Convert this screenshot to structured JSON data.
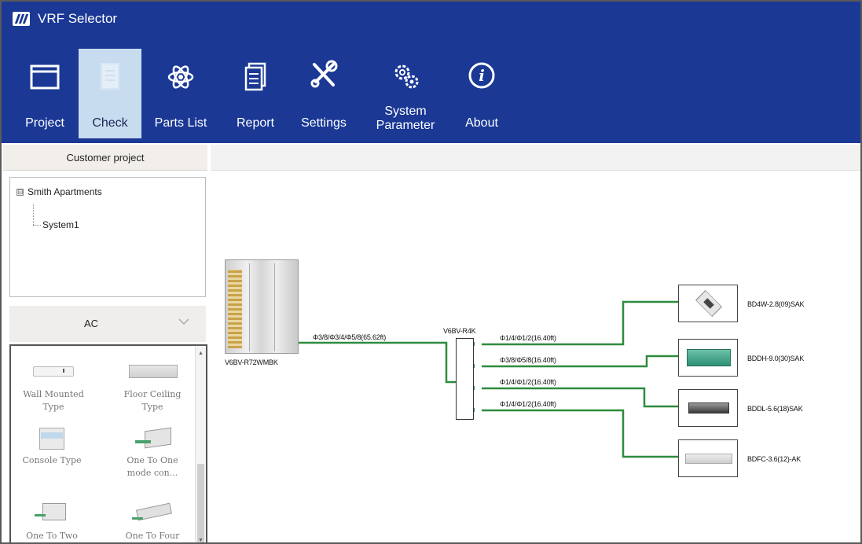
{
  "app": {
    "title": "VRF Selector"
  },
  "toolbar": {
    "project": "Project",
    "check": "Check",
    "parts_list": "Parts List",
    "report": "Report",
    "settings": "Settings",
    "system_parameter_line1": "System",
    "system_parameter_line2": "Parameter",
    "about": "About"
  },
  "left_panel": {
    "header": "Customer project",
    "tree": {
      "root": "Smith Apartments",
      "child": "System1",
      "toggle": "⊟"
    },
    "category": "AC",
    "palette": [
      {
        "name": "Wall Mounted Type",
        "line1": "Wall Mounted",
        "line2": "Type"
      },
      {
        "name": "Floor Ceiling Type",
        "line1": "Floor Ceiling",
        "line2": "Type"
      },
      {
        "name": "Console Type",
        "line1": "Console Type",
        "line2": ""
      },
      {
        "name": "One To One mode con...",
        "line1": "One To One",
        "line2": "mode con..."
      },
      {
        "name": "One To Two",
        "line1": "One To Two",
        "line2": ""
      },
      {
        "name": "One To Four",
        "line1": "One To Four",
        "line2": ""
      }
    ]
  },
  "diagram": {
    "outdoor_unit": "V6BV-R72WMBK",
    "main_pipe": "Φ3/8/Φ3/4/Φ5/8(65.62ft)",
    "branch": "V6BV-R4K",
    "pipes": [
      "Φ1/4/Φ1/2(16.40ft)",
      "Φ3/8/Φ5/8(16.40ft)",
      "Φ1/4/Φ1/2(16.40ft)",
      "Φ1/4/Φ1/2(16.40ft)"
    ],
    "indoor_units": [
      "BD4W-2.8(09)SAK",
      "BDDH-9.0(30)SAK",
      "BDDL-5.6(18)SAK",
      "BDFC-3.6(12)-AK"
    ]
  },
  "colors": {
    "ribbon": "#1a3894",
    "active_tab": "#c8dcf0",
    "pipe": "#2e8b3e"
  },
  "icons": [
    "app-logo-icon",
    "folder-icon",
    "clipboard-icon",
    "atom-icon",
    "document-icon",
    "tools-icon",
    "gear-icon",
    "info-icon",
    "chevron-down-icon"
  ]
}
